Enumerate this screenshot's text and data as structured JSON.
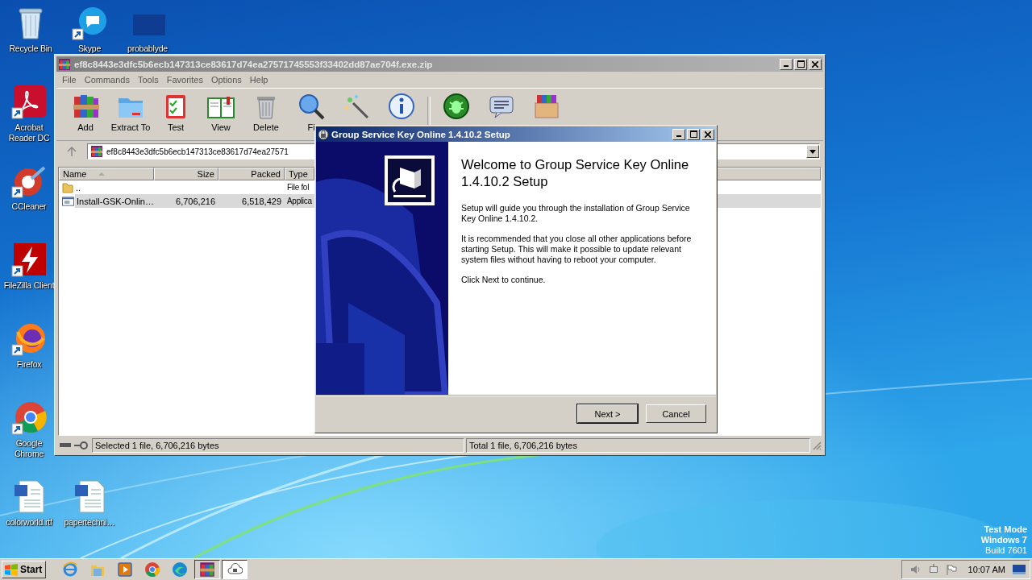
{
  "desktop_icons": [
    {
      "label": "Recycle Bin",
      "kind": "recycle"
    },
    {
      "label": "Skype",
      "kind": "skype"
    },
    {
      "label": "probablyde",
      "kind": "blank"
    },
    {
      "label": "Acrobat Reader DC",
      "kind": "acrobat"
    },
    {
      "label": "CCleaner",
      "kind": "ccleaner"
    },
    {
      "label": "FileZilla Client",
      "kind": "filezilla"
    },
    {
      "label": "Firefox",
      "kind": "firefox"
    },
    {
      "label": "Google Chrome",
      "kind": "chrome"
    },
    {
      "label": "colorworld.rtf",
      "kind": "word"
    },
    {
      "label": "papertechni…",
      "kind": "word"
    }
  ],
  "os_info": [
    "Test Mode",
    "Windows 7",
    "Build 7601"
  ],
  "winrar": {
    "title": "ef8c8443e3dfc5b6ecb147313ce83617d74ea27571745553f33402dd87ae704f.exe.zip",
    "menu": [
      "File",
      "Commands",
      "Tools",
      "Favorites",
      "Options",
      "Help"
    ],
    "toolbar": [
      {
        "kind": "add",
        "label": "Add"
      },
      {
        "kind": "extract",
        "label": "Extract To"
      },
      {
        "kind": "test",
        "label": "Test"
      },
      {
        "kind": "view",
        "label": "View"
      },
      {
        "kind": "delete",
        "label": "Delete"
      },
      {
        "kind": "find",
        "label": "Fi"
      },
      {
        "kind": "wizard"
      },
      {
        "kind": "info"
      },
      {
        "kind": "separator"
      },
      {
        "kind": "virus"
      },
      {
        "kind": "comment"
      },
      {
        "kind": "sfx"
      }
    ],
    "address": "ef8c8443e3dfc5b6ecb147313ce83617d74ea27571",
    "columns": [
      "Name",
      "Size",
      "Packed",
      "Type"
    ],
    "rows": [
      {
        "kind": "folder",
        "name": "..",
        "type": "File fol",
        "selected": false
      },
      {
        "kind": "file",
        "name": "Install-GSK-Onlin…",
        "size": "6,706,216",
        "packed": "6,518,429",
        "type": "Applica",
        "selected": true
      }
    ],
    "status": {
      "selected": "Selected 1 file, 6,706,216 bytes",
      "total": "Total 1 file, 6,706,216 bytes"
    }
  },
  "setup": {
    "title": "Group Service Key Online 1.4.10.2 Setup",
    "heading": "Welcome to Group Service Key Online 1.4.10.2 Setup",
    "paragraphs": [
      "Setup will guide you through the installation of Group Service Key Online 1.4.10.2.",
      "It is recommended that you close all other applications before starting Setup. This will make it possible to update relevant system files without having to reboot your computer.",
      "Click Next to continue."
    ],
    "buttons": [
      {
        "label": "Next >",
        "default": true
      },
      {
        "label": "Cancel",
        "default": false
      }
    ]
  },
  "taskbar": {
    "start": "Start",
    "apps": [
      {
        "kind": "ie",
        "open": false,
        "active": false
      },
      {
        "kind": "explorer",
        "open": false,
        "active": false
      },
      {
        "kind": "media",
        "open": false,
        "active": false
      },
      {
        "kind": "chrome",
        "open": false,
        "active": false
      },
      {
        "kind": "edge",
        "open": false,
        "active": false
      },
      {
        "kind": "winrar",
        "open": true,
        "active": false
      },
      {
        "kind": "setup",
        "open": true,
        "active": true
      }
    ],
    "clock": "10:07 AM"
  }
}
